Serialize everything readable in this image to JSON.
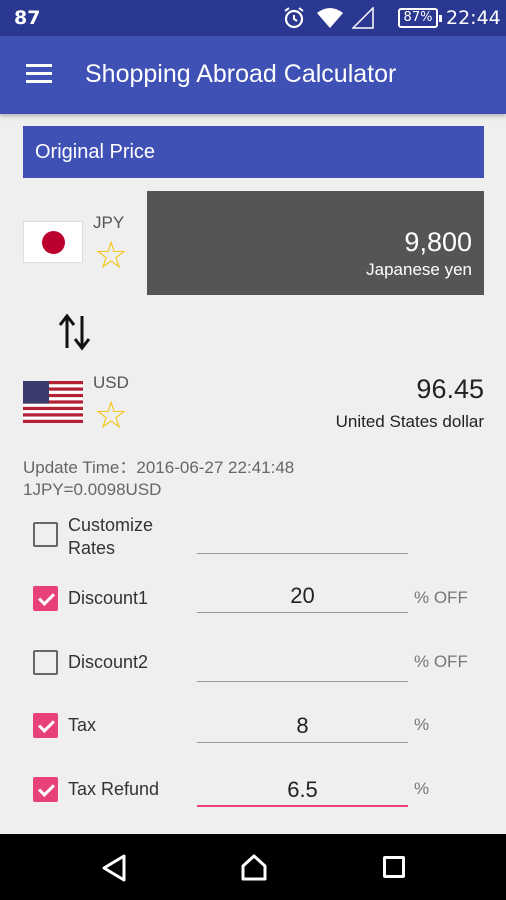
{
  "status_bar": {
    "left_text": "87",
    "battery": "87%",
    "time": "22:44"
  },
  "app_bar": {
    "title": "Shopping Abroad Calculator"
  },
  "section": {
    "title": "Original Price"
  },
  "from": {
    "code": "JPY",
    "amount": "9,800",
    "name": "Japanese yen"
  },
  "to": {
    "code": "USD",
    "amount": "96.45",
    "name": "United States dollar"
  },
  "update": {
    "time": "Update Time：2016-06-27 22:41:48",
    "rate": "1JPY=0.0098USD"
  },
  "options": [
    {
      "label": "Customize Rates",
      "checked": false,
      "value": "",
      "suffix": ""
    },
    {
      "label": "Discount1",
      "checked": true,
      "value": "20",
      "suffix": "% OFF"
    },
    {
      "label": "Discount2",
      "checked": false,
      "value": "",
      "suffix": "% OFF"
    },
    {
      "label": "Tax",
      "checked": true,
      "value": "8",
      "suffix": "%"
    },
    {
      "label": "Tax Refund",
      "checked": true,
      "value": "6.5",
      "suffix": "%"
    }
  ],
  "colors": {
    "primary": "#3f51b5",
    "status_bar": "#2a3891",
    "accent": "#e8407a",
    "star": "#f4c20d"
  }
}
